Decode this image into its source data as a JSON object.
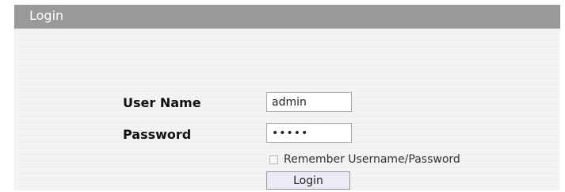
{
  "panel": {
    "title": "Login"
  },
  "form": {
    "username_label": "User Name",
    "username_value": "admin",
    "password_label": "Password",
    "password_value": "admin",
    "remember_label": "Remember Username/Password",
    "remember_checked": false,
    "login_button": "Login"
  },
  "colors": {
    "header_bg": "#999999",
    "panel_bg": "#f4f4f4",
    "button_bg": "#ecebf5"
  }
}
